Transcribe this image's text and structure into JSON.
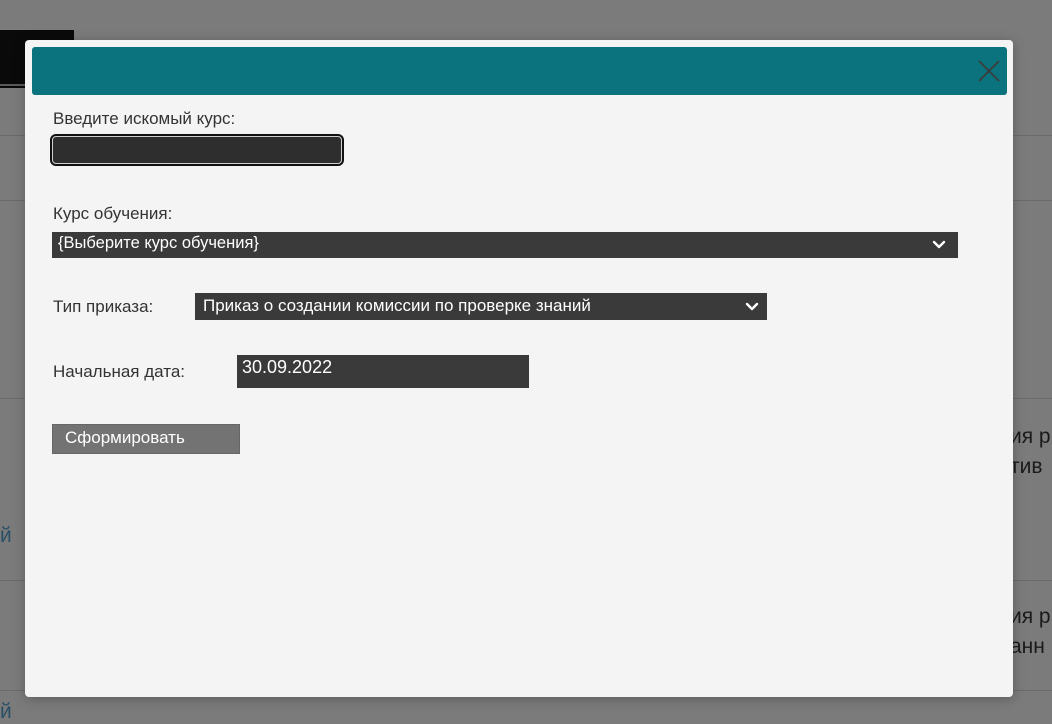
{
  "background": {
    "row1_line1": "ия р",
    "row1_line2": "тив",
    "row1_left": "й",
    "row2_line1": "ия р",
    "row2_line2": "анн",
    "row2_left": "й"
  },
  "modal": {
    "close_icon": "close-icon",
    "search": {
      "label": "Введите искомый курс:",
      "value": ""
    },
    "course": {
      "label": "Курс обучения:",
      "selected": "{Выберите курс обучения}"
    },
    "order_type": {
      "label": "Тип приказа:",
      "selected": "Приказ о создании комиссии по проверке знаний"
    },
    "start_date": {
      "label": "Начальная дата:",
      "value": "30.09.2022"
    },
    "submit_label": "Сформировать"
  },
  "colors": {
    "header": "#0b737e",
    "overlay": "#7b7b7b",
    "modal_bg": "#f4f4f4",
    "field_bg": "#3a3a3a"
  }
}
